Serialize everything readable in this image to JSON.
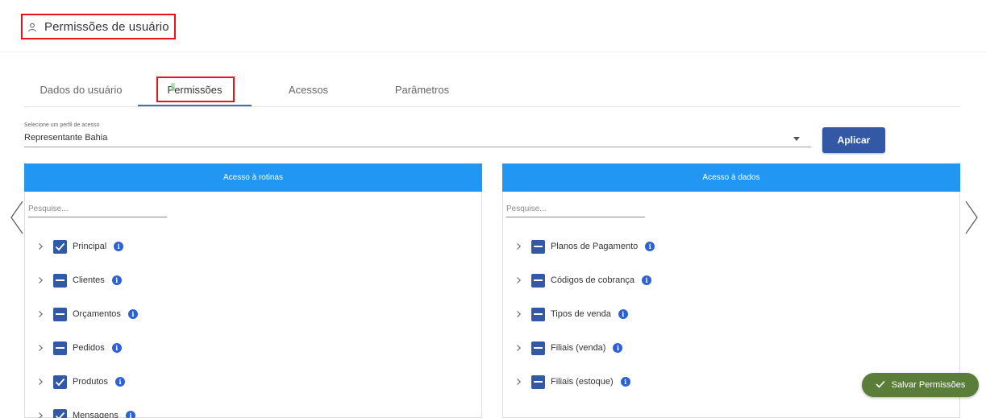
{
  "header": {
    "title": "Permissões de usuário",
    "icon": "user-icon"
  },
  "tabs": [
    {
      "label": "Dados do usuário",
      "active": false
    },
    {
      "label": "Permissões",
      "active": true
    },
    {
      "label": "Acessos",
      "active": false
    },
    {
      "label": "Parâmetros",
      "active": false
    }
  ],
  "profile": {
    "label": "Selecione um perfil de acesso",
    "value": "Representante Bahia",
    "apply_label": "Aplicar"
  },
  "routines_panel": {
    "title": "Acesso à rotinas",
    "search_placeholder": "Pesquise...",
    "items": [
      {
        "label": "Principal",
        "state": "checked"
      },
      {
        "label": "Clientes",
        "state": "indeterminate"
      },
      {
        "label": "Orçamentos",
        "state": "indeterminate"
      },
      {
        "label": "Pedidos",
        "state": "indeterminate"
      },
      {
        "label": "Produtos",
        "state": "checked"
      },
      {
        "label": "Mensagens",
        "state": "checked"
      }
    ]
  },
  "data_panel": {
    "title": "Acesso à dados",
    "search_placeholder": "Pesquise...",
    "items": [
      {
        "label": "Planos de Pagamento",
        "state": "indeterminate"
      },
      {
        "label": "Códigos de cobrança",
        "state": "indeterminate"
      },
      {
        "label": "Tipos de venda",
        "state": "indeterminate"
      },
      {
        "label": "Filiais (venda)",
        "state": "indeterminate"
      },
      {
        "label": "Filiais (estoque)",
        "state": "indeterminate"
      }
    ]
  },
  "save": {
    "label": "Salvar Permissões"
  },
  "colors": {
    "accent": "#3358a6",
    "panel_header": "#2196f3",
    "info": "#2c62d6",
    "save": "#5a7e3a",
    "highlight": "#e8131b"
  }
}
